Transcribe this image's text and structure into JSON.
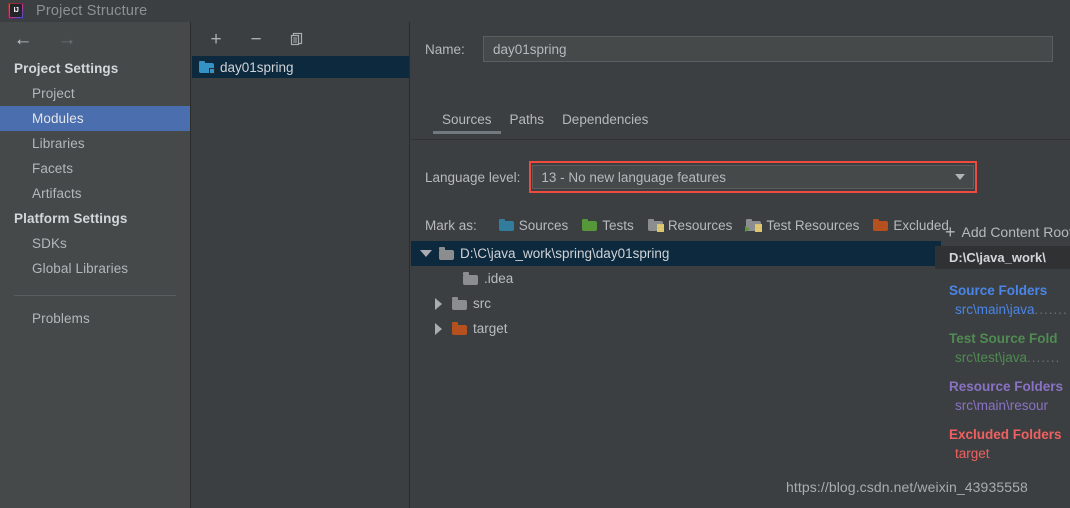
{
  "window": {
    "title": "Project Structure",
    "app_icon": "intellij-idea-icon"
  },
  "navigation": {
    "back_icon": "arrow-left-icon",
    "forward_icon": "arrow-right-icon"
  },
  "sidebar": {
    "groups": [
      {
        "label": "Project Settings",
        "items": [
          {
            "label": "Project",
            "selected": false
          },
          {
            "label": "Modules",
            "selected": true
          },
          {
            "label": "Libraries",
            "selected": false
          },
          {
            "label": "Facets",
            "selected": false
          },
          {
            "label": "Artifacts",
            "selected": false
          }
        ]
      },
      {
        "label": "Platform Settings",
        "items": [
          {
            "label": "SDKs",
            "selected": false
          },
          {
            "label": "Global Libraries",
            "selected": false
          }
        ]
      }
    ],
    "problems_label": "Problems"
  },
  "modules_panel": {
    "toolbar": {
      "add_label": "+",
      "remove_label": "−",
      "copy_icon": "copy-icon"
    },
    "modules": [
      {
        "name": "day01spring",
        "selected": true
      }
    ]
  },
  "main": {
    "name_label": "Name:",
    "name_value": "day01spring",
    "tabs": [
      {
        "label": "Sources",
        "active": true
      },
      {
        "label": "Paths",
        "active": false
      },
      {
        "label": "Dependencies",
        "active": false
      }
    ],
    "language_level": {
      "label": "Language level:",
      "value": "13 - No new language features",
      "highlight_color": "#f04a3f",
      "caret_icon": "chevron-down-icon"
    },
    "mark_as": {
      "label": "Mark as:",
      "options": [
        {
          "label": "Sources",
          "mnemonic": "S",
          "color": "teal"
        },
        {
          "label": "Tests",
          "mnemonic": "T",
          "color": "green"
        },
        {
          "label": "Resources",
          "mnemonic": "",
          "color": "grey"
        },
        {
          "label": "Test Resources",
          "mnemonic": "",
          "color": "grey"
        },
        {
          "label": "Excluded",
          "mnemonic": "E",
          "color": "orange"
        }
      ]
    },
    "tree": [
      {
        "label": "D:\\C\\java_work\\spring\\day01spring",
        "twisty": "open",
        "indent": 0,
        "color": "grey",
        "selected": true
      },
      {
        "label": ".idea",
        "twisty": "none",
        "indent": 1,
        "color": "grey",
        "selected": false
      },
      {
        "label": "src",
        "twisty": "closed",
        "indent": 1,
        "color": "grey",
        "selected": false
      },
      {
        "label": "target",
        "twisty": "closed",
        "indent": 1,
        "color": "orange",
        "selected": false
      }
    ]
  },
  "info_rail": {
    "add_content_root": "Add Content Root",
    "add_icon": "plus-icon",
    "root_path": "D:\\C\\java_work\\",
    "sections": [
      {
        "title": "Source Folders",
        "path": "src\\main\\java",
        "color_class": "c-source"
      },
      {
        "title": "Test Source Fold",
        "path": "src\\test\\java",
        "color_class": "c-test"
      },
      {
        "title": "Resource Folders",
        "path": "src\\main\\resour",
        "color_class": "c-res"
      },
      {
        "title": "Excluded Folders",
        "path": "target",
        "color_class": "c-excl"
      }
    ]
  },
  "watermark": {
    "text": "https://blog.csdn.net/weixin_43935558"
  },
  "colors": {
    "background": "#3c3f41",
    "sidebar": "#45494a",
    "selection_blue": "#4b6eaf",
    "tree_selection": "#0d293e",
    "accent_red": "#f04a3f"
  }
}
